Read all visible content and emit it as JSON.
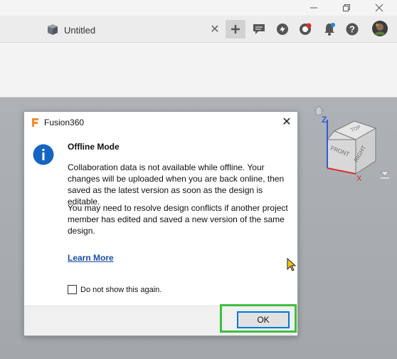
{
  "window": {
    "controls": {
      "minimize_icon": "minimize-icon",
      "restore_icon": "restore-icon",
      "close_icon": "close-icon"
    }
  },
  "tabbar": {
    "document_tab": {
      "label": "Untitled",
      "icon": "cube-icon",
      "close_glyph": "✕"
    },
    "new_tab_icon": "plus-icon",
    "icons": [
      "chat-icon",
      "job-status-icon",
      "history-icon",
      "notification-icon",
      "help-icon",
      "avatar"
    ]
  },
  "dialog": {
    "app_name": "Fusion360",
    "close_glyph": "✕",
    "heading": "Offline Mode",
    "paragraph1": "Collaboration data is not available while offline. Your changes will be uploaded when you are back online, then saved as the latest version as soon as the design is editable.",
    "paragraph2": "You may need to resolve design conflicts if another project member has edited and saved a new version of the same design.",
    "learn_more": "Learn More",
    "checkbox_label": "Do not show this again.",
    "checkbox_checked": false,
    "ok_label": "OK",
    "accent": "#0078d7",
    "highlight_color": "#3fbf3f"
  },
  "viewcube": {
    "faces": {
      "top": "TOP",
      "front": "FRONT",
      "right": "RIGHT"
    },
    "axes": {
      "z": "Z",
      "x": "X"
    }
  }
}
